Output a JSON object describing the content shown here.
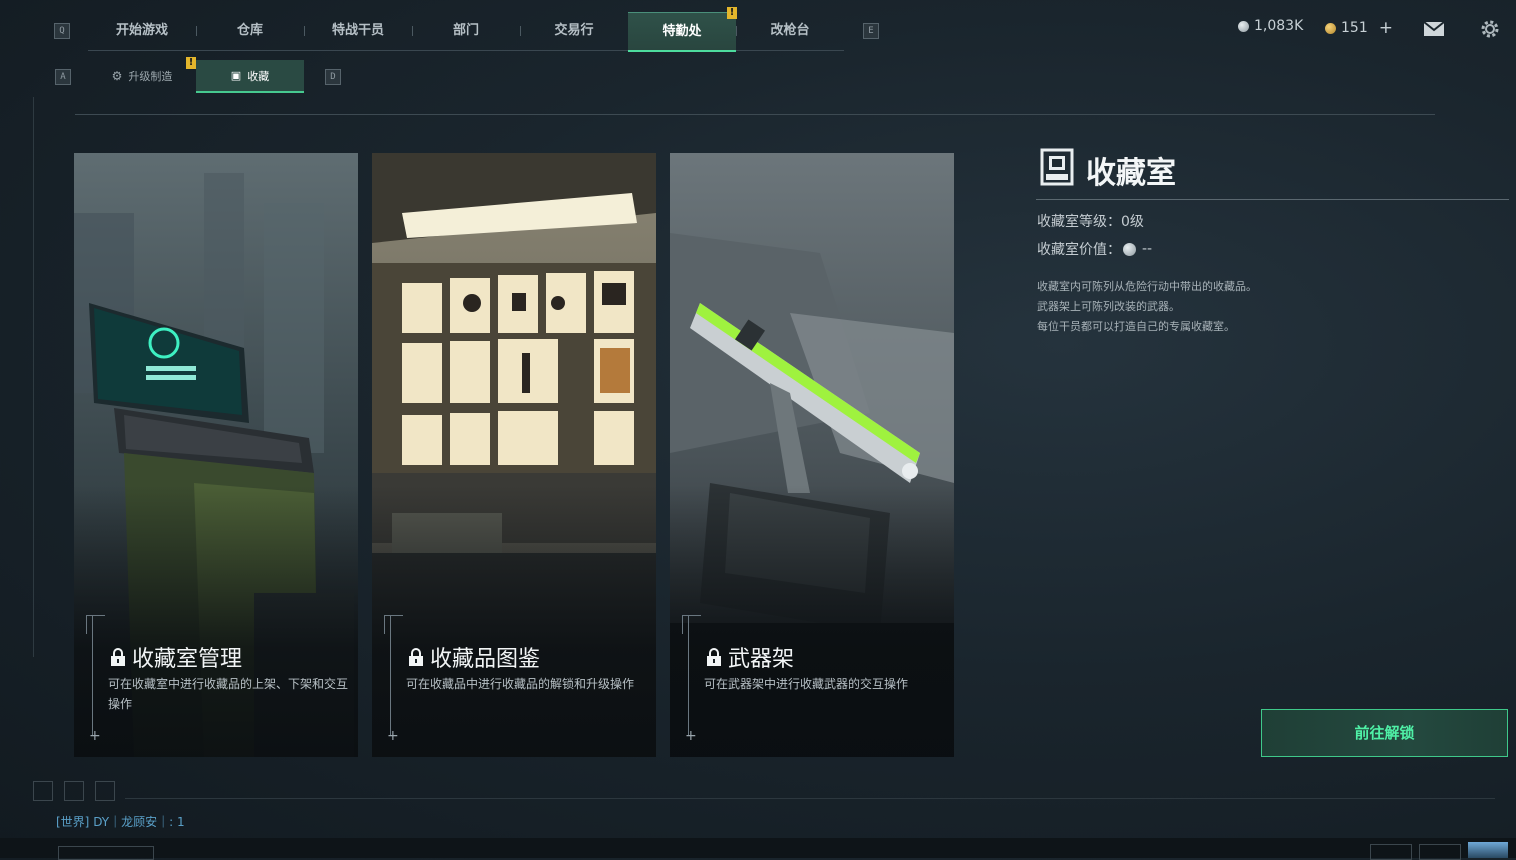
{
  "nav": {
    "left_key": "Q",
    "right_key": "E",
    "tabs": [
      {
        "label": "开始游戏"
      },
      {
        "label": "仓库"
      },
      {
        "label": "特战干员"
      },
      {
        "label": "部门"
      },
      {
        "label": "交易行"
      },
      {
        "label": "特勤处",
        "active": true,
        "badge": "!"
      },
      {
        "label": "改枪台"
      }
    ]
  },
  "currency": {
    "silver": "1,083K",
    "gold": "151",
    "add_label": "+"
  },
  "subnav": {
    "left_key": "A",
    "right_key": "D",
    "tabs": [
      {
        "label": "升级制造",
        "badge": "!"
      },
      {
        "label": "收藏",
        "active": true
      }
    ]
  },
  "cards": [
    {
      "title": "收藏室管理",
      "desc": "可在收藏室中进行收藏品的上架、下架和交互操作",
      "locked": true
    },
    {
      "title": "收藏品图鉴",
      "desc": "可在收藏品中进行收藏品的解锁和升级操作",
      "locked": true,
      "selected": true
    },
    {
      "title": "武器架",
      "desc": "可在武器架中进行收藏武器的交互操作",
      "locked": true
    }
  ],
  "panel": {
    "title": "收藏室",
    "level_label": "收藏室等级：",
    "level_value": "0级",
    "value_label": "收藏室价值：",
    "value_value": "--",
    "desc": [
      "收藏室内可陈列从危险行动中带出的收藏品。",
      "武器架上可陈列改装的武器。",
      "每位干员都可以打造自己的专属收藏室。"
    ],
    "unlock_button": "前往解锁"
  },
  "chat": {
    "channel": "[世界]",
    "text": "DY｜龙顾安｜: 1"
  },
  "colors": {
    "accent": "#4ddc9e",
    "warning": "#e3b62c"
  }
}
